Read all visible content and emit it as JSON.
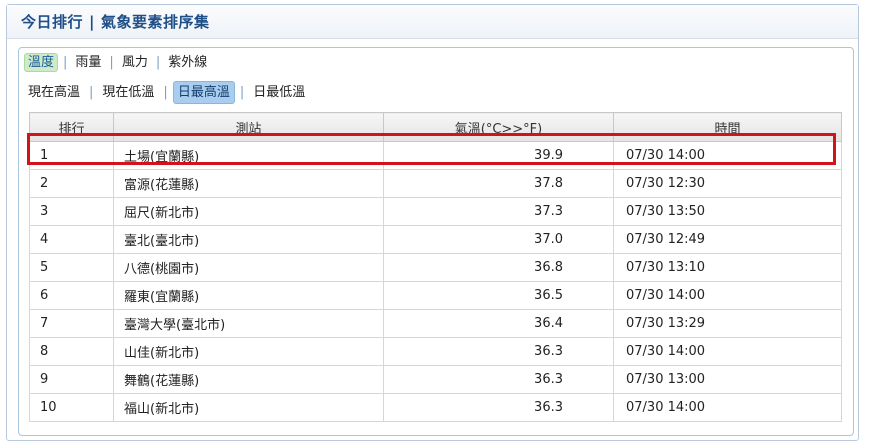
{
  "header": {
    "title_left": "今日排行",
    "separator": "|",
    "title_right": "氣象要素排序集"
  },
  "category_tabs": [
    {
      "label": "溫度",
      "active": true
    },
    {
      "label": "雨量",
      "active": false
    },
    {
      "label": "風力",
      "active": false
    },
    {
      "label": "紫外線",
      "active": false
    }
  ],
  "sub_tabs": [
    {
      "label": "現在高溫",
      "active": false
    },
    {
      "label": "現在低溫",
      "active": false
    },
    {
      "label": "日最高溫",
      "active": true
    },
    {
      "label": "日最低溫",
      "active": false
    }
  ],
  "table": {
    "columns": [
      "排行",
      "測站",
      "氣溫(°C>>°F)",
      "時間"
    ],
    "rows": [
      {
        "rank": "1",
        "station": "土場(宜蘭縣)",
        "temp": "39.9",
        "time": "07/30 14:00"
      },
      {
        "rank": "2",
        "station": "富源(花蓮縣)",
        "temp": "37.8",
        "time": "07/30 12:30"
      },
      {
        "rank": "3",
        "station": "屈尺(新北市)",
        "temp": "37.3",
        "time": "07/30 13:50"
      },
      {
        "rank": "4",
        "station": "臺北(臺北市)",
        "temp": "37.0",
        "time": "07/30 12:49"
      },
      {
        "rank": "5",
        "station": "八德(桃園市)",
        "temp": "36.8",
        "time": "07/30 13:10"
      },
      {
        "rank": "6",
        "station": "羅東(宜蘭縣)",
        "temp": "36.5",
        "time": "07/30 14:00"
      },
      {
        "rank": "7",
        "station": "臺灣大學(臺北市)",
        "temp": "36.4",
        "time": "07/30 13:29"
      },
      {
        "rank": "8",
        "station": "山佳(新北市)",
        "temp": "36.3",
        "time": "07/30 14:00"
      },
      {
        "rank": "9",
        "station": "舞鶴(花蓮縣)",
        "temp": "36.3",
        "time": "07/30 13:00"
      },
      {
        "rank": "10",
        "station": "福山(新北市)",
        "temp": "36.3",
        "time": "07/30 14:00"
      }
    ]
  },
  "highlight_color": "#d3131b"
}
